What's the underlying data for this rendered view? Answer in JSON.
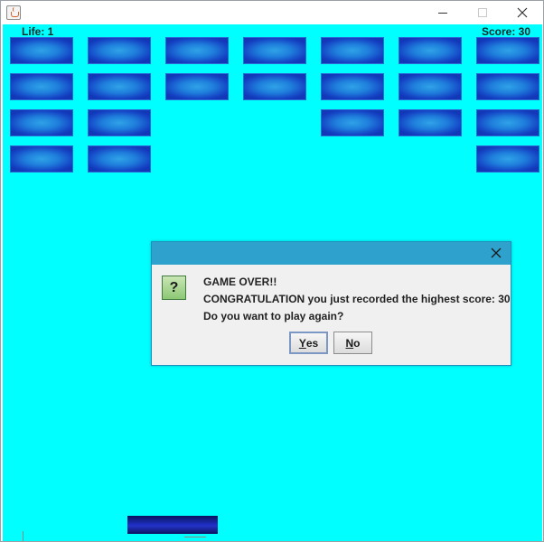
{
  "window": {
    "icon": "java-cup-icon",
    "controls": [
      "minimize-icon",
      "maximize-icon",
      "close-icon"
    ]
  },
  "hud": {
    "life_label": "Life: 1",
    "score_label": "Score:  30"
  },
  "game": {
    "background_color": "#00ffff",
    "brick_color": "#1f7fdc",
    "paddle_color": "#1c2db8",
    "bricks_visible": [
      [
        true,
        true,
        true,
        true,
        true,
        true,
        true
      ],
      [
        true,
        true,
        true,
        true,
        true,
        true,
        true
      ],
      [
        true,
        true,
        false,
        false,
        true,
        true,
        true
      ],
      [
        true,
        true,
        false,
        false,
        false,
        false,
        true
      ]
    ]
  },
  "dialog": {
    "icon": "question-icon",
    "icon_glyph": "?",
    "message_lines": [
      "GAME OVER!!",
      "CONGRATULATION you just recorded the highest score: 30",
      "Do you want to play again?"
    ],
    "yes_button": {
      "mnemonic": "Y",
      "rest": "es"
    },
    "no_button": {
      "mnemonic": "N",
      "rest": "o"
    },
    "title_color": "#2ea2cc"
  }
}
